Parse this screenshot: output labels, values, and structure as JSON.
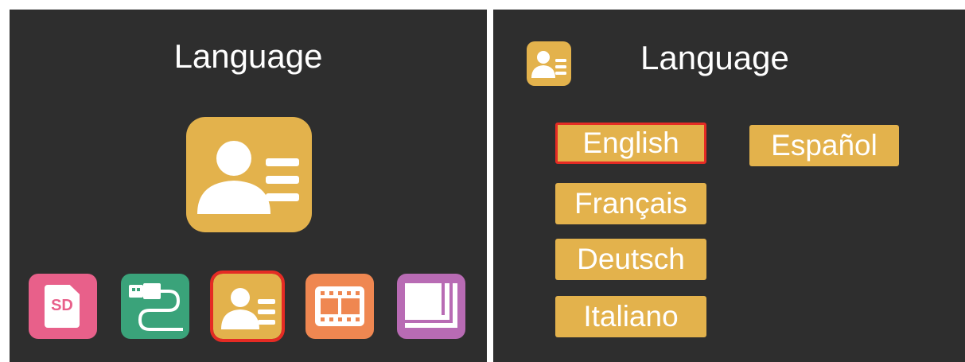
{
  "colors": {
    "screen_bg": "#2e2e2e",
    "accent_gold": "#e3b24c",
    "selection_red": "#e52b24",
    "sd_pink": "#e8608a",
    "usb_green": "#3aa37a",
    "video_orange": "#ef8751",
    "slideshow_purple": "#b86bb4",
    "text": "#ffffff"
  },
  "left_screen": {
    "title": "Language",
    "preview_icon": "language-contact-card-icon",
    "mode_bar": [
      {
        "icon": "sd-card-icon",
        "label": "SD",
        "selected": false
      },
      {
        "icon": "usb-cable-icon",
        "selected": false
      },
      {
        "icon": "language-contact-card-icon",
        "selected": true
      },
      {
        "icon": "film-strip-icon",
        "selected": false
      },
      {
        "icon": "slideshow-frames-icon",
        "selected": false
      }
    ]
  },
  "right_screen": {
    "header_icon": "language-contact-card-icon",
    "title": "Language",
    "languages": [
      {
        "label": "English",
        "selected": true
      },
      {
        "label": "Español",
        "selected": false
      },
      {
        "label": "Français",
        "selected": false
      },
      {
        "label": "Deutsch",
        "selected": false
      },
      {
        "label": "Italiano",
        "selected": false
      }
    ]
  }
}
